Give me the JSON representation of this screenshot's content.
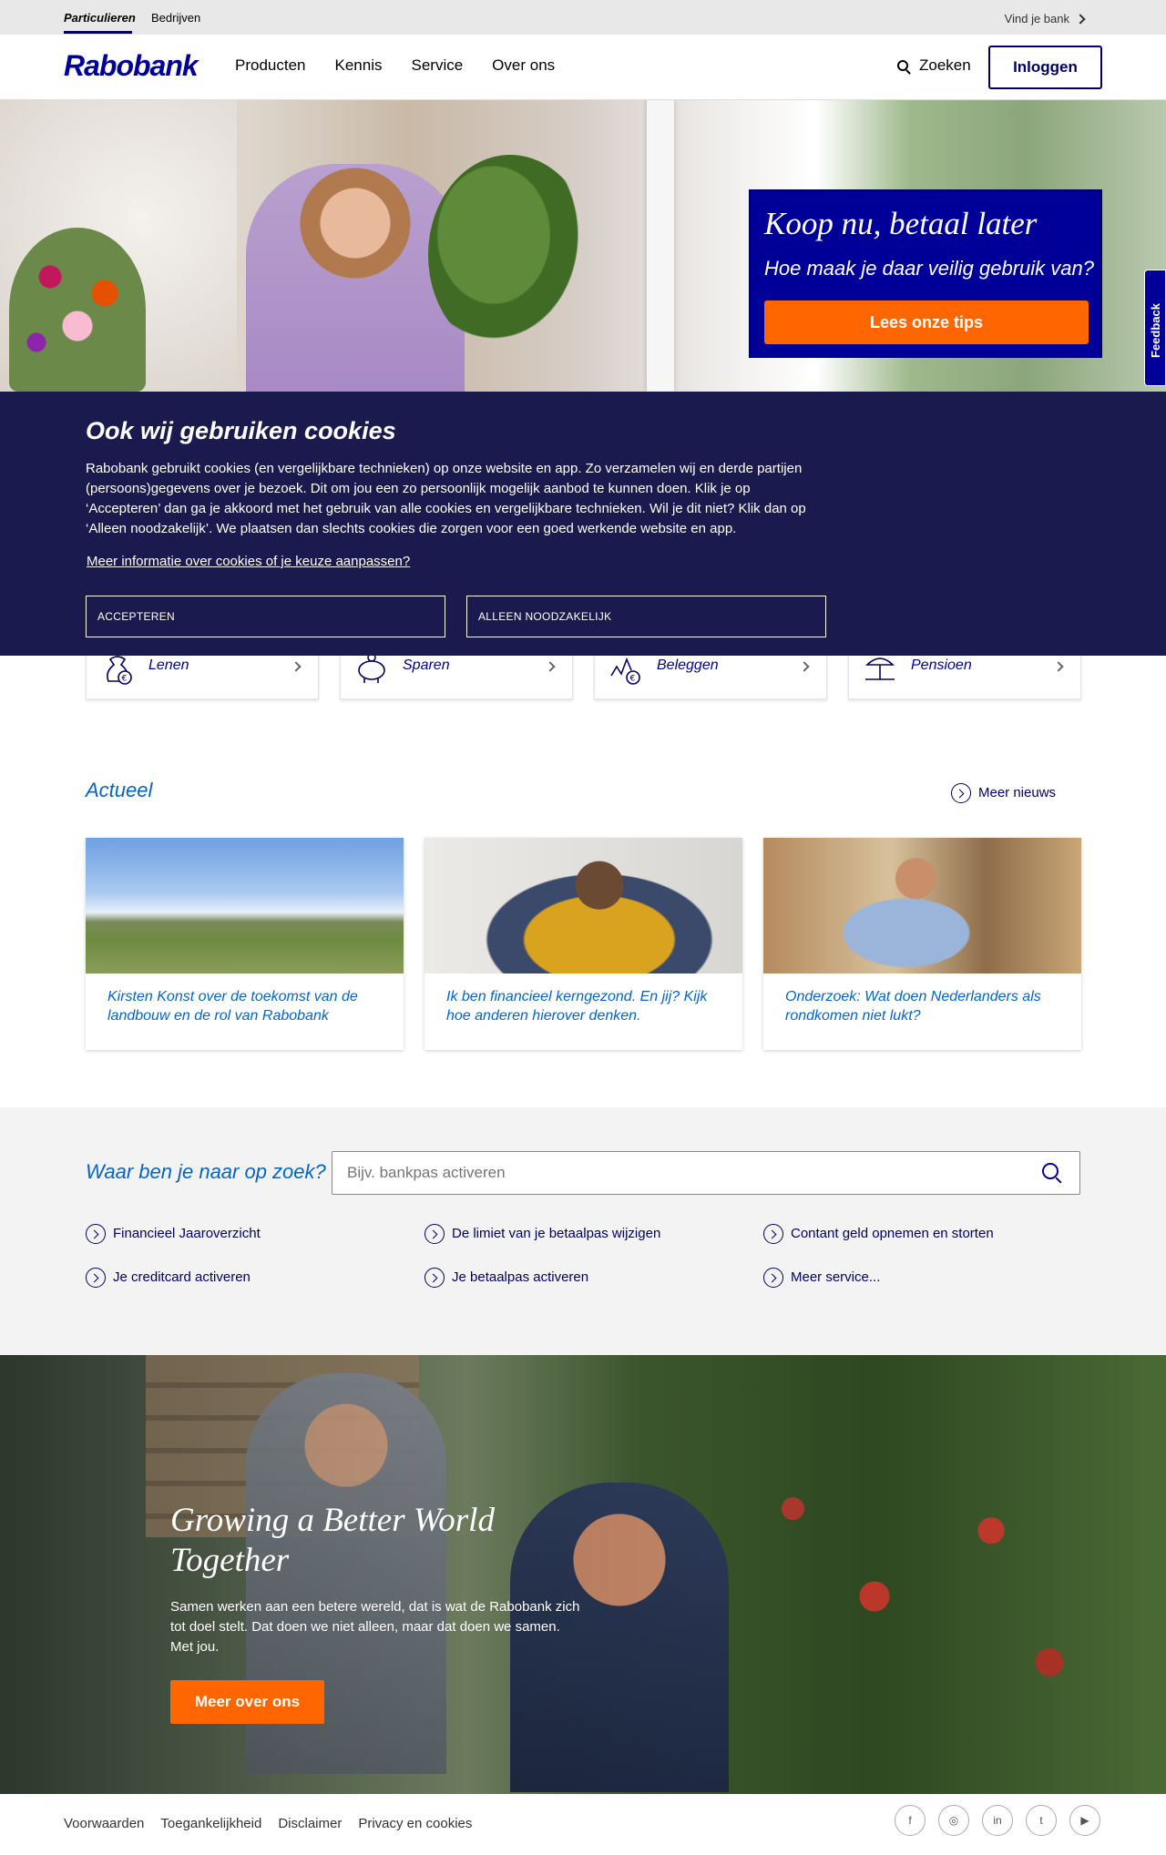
{
  "utility": {
    "segments": [
      "Particulieren",
      "Bedrijven"
    ],
    "find_bank": "Vind je bank"
  },
  "header": {
    "logo": "Rabobank",
    "nav": [
      "Producten",
      "Kennis",
      "Service",
      "Over ons"
    ],
    "search": "Zoeken",
    "login": "Inloggen"
  },
  "hero": {
    "title": "Koop nu, betaal later",
    "subtitle": "Hoe maak je daar veilig gebruik van?",
    "button": "Lees onze tips"
  },
  "feedback": "Feedback",
  "cookie": {
    "title": "Ook wij gebruiken cookies",
    "text": "Rabobank gebruikt cookies (en vergelijkbare technieken) op onze website en app. Zo verzamelen wij en derde partijen (persoons)gegevens over je bezoek. Dit om jou een zo persoonlijk mogelijk aanbod te kunnen doen. Klik je op ‘Accepteren’ dan ga je akkoord met het gebruik van alle cookies en vergelijkbare technieken. Wil je dit niet? Klik dan op ‘Alleen noodzakelijk’. We plaatsen dan slechts cookies die zorgen voor een goed werkende website en app.",
    "link": "Meer informatie over cookies of je keuze aanpassen?",
    "accept": "ACCEPTEREN",
    "necessary": "ALLEEN NOODZAKELIJK"
  },
  "products": [
    {
      "label": "Lenen",
      "icon": "money-bag-euro-icon"
    },
    {
      "label": "Sparen",
      "icon": "piggy-bank-icon"
    },
    {
      "label": "Beleggen",
      "icon": "stock-chart-euro-icon"
    },
    {
      "label": "Pensioen",
      "icon": "beach-umbrella-icon"
    }
  ],
  "actueel": {
    "title": "Actueel",
    "more": "Meer nieuws",
    "cards": [
      {
        "text": "Kirsten Konst over de toekomst van de landbouw en de rol van Rabobank"
      },
      {
        "text": "Ik ben financieel kerngezond. En jij? Kijk hoe anderen hierover denken."
      },
      {
        "text": "Onderzoek: Wat doen Nederlanders als rondkomen niet lukt?"
      }
    ]
  },
  "search": {
    "title": "Waar ben je naar op zoek?",
    "placeholder": "Bijv. bankpas activeren",
    "links": [
      "Financieel Jaaroverzicht",
      "De limiet van je betaalpas wijzigen",
      "Contant geld opnemen en storten",
      "Je creditcard activeren",
      "Je betaalpas activeren",
      "Meer service..."
    ]
  },
  "growing": {
    "title": "Growing a Better World Together",
    "text": "Samen werken aan een betere wereld, dat is wat de Rabobank zich tot doel stelt. Dat doen we niet alleen, maar dat doen we samen. Met jou.",
    "button": "Meer over ons"
  },
  "footer": {
    "links": [
      "Voorwaarden",
      "Toegankelijkheid",
      "Disclaimer",
      "Privacy en cookies"
    ],
    "social": [
      "facebook-icon",
      "instagram-icon",
      "linkedin-icon",
      "twitter-icon",
      "youtube-icon"
    ],
    "social_glyphs": [
      "f",
      "◎",
      "in",
      "t",
      "▶"
    ]
  },
  "colors": {
    "brand_blue": "#000099",
    "accent_orange": "#ff6600",
    "cookie_bg": "#1a1a4e",
    "link_blue": "#0066cc"
  }
}
